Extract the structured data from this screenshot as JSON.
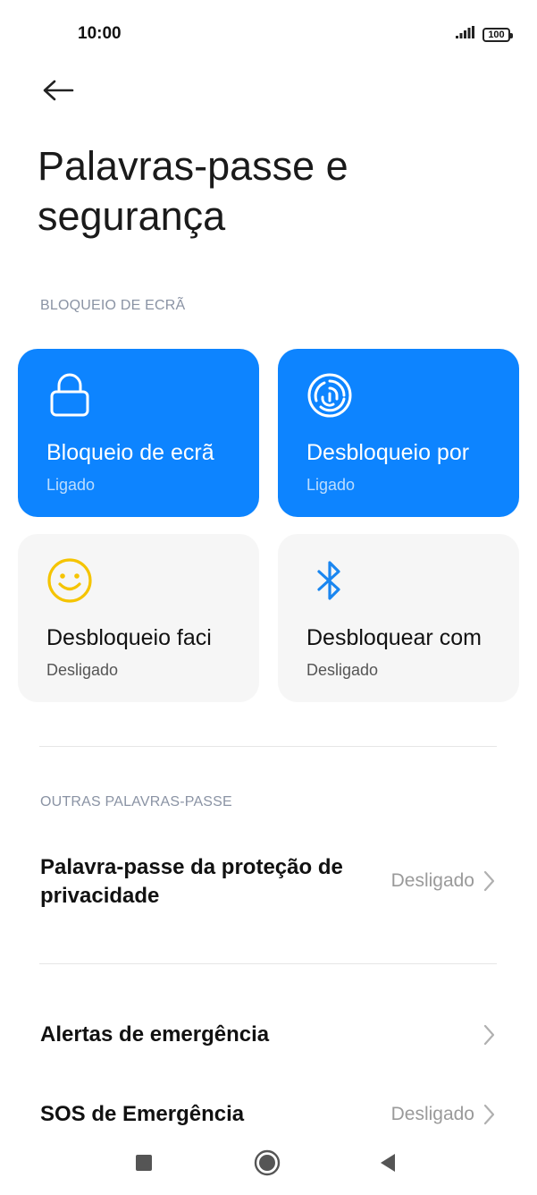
{
  "status_bar": {
    "time": "10:00",
    "battery": "100"
  },
  "header": {
    "title": "Palavras-passe e segurança"
  },
  "screen_lock": {
    "section_title": "BLOQUEIO DE ECRÃ",
    "cards": [
      {
        "title": "Bloqueio de ecrã",
        "status": "Ligado",
        "icon": "lock-icon"
      },
      {
        "title": "Desbloqueio por",
        "status": "Ligado",
        "icon": "fingerprint-icon"
      },
      {
        "title": "Desbloqueio faci",
        "status": "Desligado",
        "icon": "face-icon"
      },
      {
        "title": "Desbloquear com",
        "status": "Desligado",
        "icon": "bluetooth-icon"
      }
    ]
  },
  "other_passwords": {
    "section_title": "OUTRAS PALAVRAS-PASSE",
    "privacy_password": {
      "title": "Palavra-passe da proteção de privacidade",
      "value": "Desligado"
    }
  },
  "emergency": {
    "alerts": {
      "title": "Alertas de emergência"
    },
    "sos": {
      "title": "SOS de Emergência",
      "value": "Desligado"
    }
  },
  "colors": {
    "accent": "#0d84ff",
    "face_icon": "#f5c400",
    "bluetooth_icon": "#1a86f0"
  }
}
